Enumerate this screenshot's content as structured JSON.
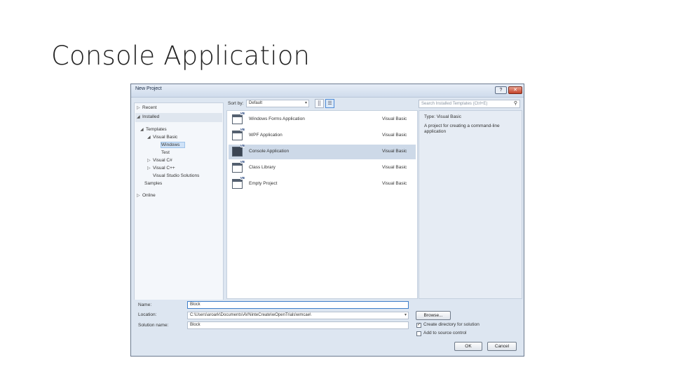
{
  "slide": {
    "title": "Console Application"
  },
  "dialog": {
    "title": "New Project",
    "help_btn": "?",
    "close_btn": "✕",
    "tree": {
      "recent": "Recent",
      "installed": "Installed",
      "templates": "Templates",
      "visual_basic": "Visual Basic",
      "windows": "Windows",
      "test": "Test",
      "visual_csharp": "Visual C#",
      "visual_cpp": "Visual C++",
      "vs_solutions": "Visual Studio Solutions",
      "samples": "Samples",
      "online": "Online"
    },
    "sort_label": "Sort by:",
    "sort_value": "Default",
    "search_placeholder": "Search Installed Templates (Ctrl+E)",
    "templates": [
      {
        "name": "Windows Forms Application",
        "lang": "Visual Basic"
      },
      {
        "name": "WPF Application",
        "lang": "Visual Basic"
      },
      {
        "name": "Console Application",
        "lang": "Visual Basic"
      },
      {
        "name": "Class Library",
        "lang": "Visual Basic"
      },
      {
        "name": "Empty Project",
        "lang": "Visual Basic"
      }
    ],
    "detail": {
      "type_label": "Type:",
      "type_value": "Visual Basic",
      "description": "A project for creating a command-line application"
    },
    "form": {
      "name_label": "Name:",
      "name_value": "Block",
      "location_label": "Location:",
      "location_value": "C:\\Users\\aroark\\Documents\\AVNinteCreate\\wOpenTrials\\wmcae\\",
      "solution_label": "Solution name:",
      "solution_value": "Block",
      "browse_label": "Browse...",
      "create_dir_label": "Create directory for solution",
      "source_control_label": "Add to source control",
      "ok_label": "OK",
      "cancel_label": "Cancel"
    }
  }
}
